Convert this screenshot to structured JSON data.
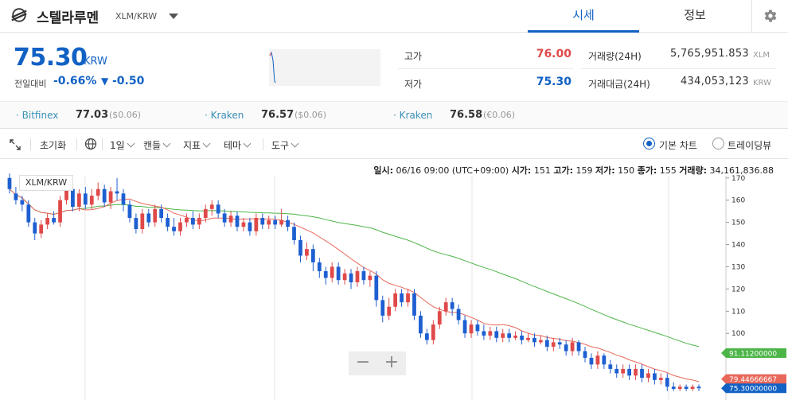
{
  "header": {
    "coin_name": "스텔라루멘",
    "pair": "XLM/KRW",
    "tabs": [
      "시세",
      "정보"
    ]
  },
  "price": {
    "value": "75.30",
    "unit": "KRW",
    "change_label": "전일대비",
    "change_rate": "-0.66%",
    "change_arrow": "▼",
    "change_amount": "-0.50"
  },
  "stats": {
    "high_label": "고가",
    "high_value": "76.00",
    "low_label": "저가",
    "low_value": "75.30",
    "volume_label": "거래량(24H)",
    "volume_value": "5,765,951.853",
    "volume_unit": "XLM",
    "amount_label": "거래대금(24H)",
    "amount_value": "434,053,123",
    "amount_unit": "KRW"
  },
  "exchanges": [
    {
      "name": "Bitfinex",
      "price": "77.03",
      "sub": "($0.06)"
    },
    {
      "name": "Kraken",
      "price": "76.57",
      "sub": "($0.06)"
    },
    {
      "name": "Kraken",
      "price": "76.58",
      "sub": "(€0.06)"
    }
  ],
  "toolbar": {
    "reset": "초기화",
    "period": "1일",
    "candle": "캔들",
    "indicator": "지표",
    "theme": "테마",
    "tools": "도구",
    "basic_chart": "기본 차트",
    "trading_view": "트레이딩뷰"
  },
  "ohlc": {
    "date_label": "일시:",
    "date": "06/16 09:00 (UTC+09:00)",
    "open_label": "시가:",
    "open": "151",
    "high_label": "고가:",
    "high": "159",
    "low_label": "저가:",
    "low": "150",
    "close_label": "종가:",
    "close": "155",
    "volume_label": "거래량:",
    "volume": "34,161,836.88"
  },
  "chart_pair_tag": "XLM/KRW",
  "zoom": {
    "minus": "−",
    "plus": "+"
  },
  "colors": {
    "accent": "#1261c4",
    "up": "#e04949",
    "down": "#1d5fd1",
    "ma_short": "#e8685a",
    "ma_long": "#4db548"
  },
  "chart_data": {
    "type": "candlestick",
    "ylim": [
      70,
      171
    ],
    "y_ticks": [
      170,
      160,
      150,
      140,
      130,
      120,
      110,
      100,
      90,
      80
    ],
    "price_tags": [
      {
        "value": 91.112,
        "label": "91.11200000",
        "color": "#4db548"
      },
      {
        "value": 79.44666667,
        "label": "79.44666667",
        "color": "#e8685a"
      },
      {
        "value": 75.3,
        "label": "75.30000000",
        "color": "#1261c4"
      }
    ],
    "candles": [
      [
        170,
        165,
        172,
        163
      ],
      [
        163,
        160,
        166,
        158
      ],
      [
        160,
        158,
        162,
        155
      ],
      [
        158,
        150,
        160,
        148
      ],
      [
        150,
        145,
        152,
        142
      ],
      [
        145,
        149,
        151,
        143
      ],
      [
        149,
        152,
        154,
        147
      ],
      [
        152,
        150,
        155,
        149
      ],
      [
        150,
        160,
        162,
        148
      ],
      [
        160,
        165,
        168,
        158
      ],
      [
        165,
        157,
        167,
        155
      ],
      [
        157,
        163,
        165,
        155
      ],
      [
        163,
        158,
        166,
        156
      ],
      [
        158,
        162,
        165,
        156
      ],
      [
        162,
        165,
        168,
        160
      ],
      [
        165,
        159,
        167,
        157
      ],
      [
        159,
        164,
        166,
        156
      ],
      [
        164,
        163,
        170,
        160
      ],
      [
        163,
        158,
        165,
        155
      ],
      [
        158,
        152,
        160,
        150
      ],
      [
        152,
        147,
        154,
        145
      ],
      [
        147,
        154,
        156,
        145
      ],
      [
        154,
        150,
        156,
        148
      ],
      [
        150,
        156,
        158,
        148
      ],
      [
        156,
        152,
        158,
        150
      ],
      [
        152,
        148,
        154,
        146
      ],
      [
        148,
        146,
        152,
        144
      ],
      [
        146,
        150,
        152,
        144
      ],
      [
        150,
        152,
        154,
        148
      ],
      [
        152,
        149,
        155,
        147
      ],
      [
        149,
        152,
        154,
        147
      ],
      [
        152,
        156,
        158,
        150
      ],
      [
        156,
        158,
        160,
        153
      ],
      [
        158,
        154,
        160,
        152
      ],
      [
        154,
        150,
        156,
        148
      ],
      [
        150,
        153,
        155,
        148
      ],
      [
        153,
        148,
        155,
        146
      ],
      [
        148,
        150,
        152,
        146
      ],
      [
        150,
        146,
        152,
        144
      ],
      [
        146,
        152,
        154,
        144
      ],
      [
        152,
        149,
        154,
        147
      ],
      [
        149,
        151,
        153,
        147
      ],
      [
        151,
        149,
        153,
        147
      ],
      [
        149,
        151,
        156,
        148
      ],
      [
        151,
        148,
        153,
        146
      ],
      [
        148,
        142,
        150,
        140
      ],
      [
        142,
        135,
        144,
        132
      ],
      [
        135,
        138,
        141,
        133
      ],
      [
        138,
        132,
        140,
        128
      ],
      [
        132,
        128,
        134,
        125
      ],
      [
        128,
        125,
        130,
        122
      ],
      [
        125,
        130,
        132,
        123
      ],
      [
        130,
        124,
        132,
        122
      ],
      [
        124,
        127,
        129,
        122
      ],
      [
        127,
        123,
        129,
        120
      ],
      [
        123,
        128,
        130,
        121
      ],
      [
        128,
        124,
        130,
        122
      ],
      [
        124,
        126,
        128,
        121
      ],
      [
        126,
        115,
        128,
        112
      ],
      [
        115,
        108,
        117,
        105
      ],
      [
        108,
        112,
        116,
        106
      ],
      [
        112,
        118,
        120,
        110
      ],
      [
        118,
        114,
        120,
        112
      ],
      [
        114,
        118,
        120,
        112
      ],
      [
        118,
        108,
        120,
        106
      ],
      [
        108,
        100,
        110,
        98
      ],
      [
        100,
        97,
        102,
        95
      ],
      [
        97,
        104,
        106,
        95
      ],
      [
        104,
        110,
        112,
        102
      ],
      [
        110,
        114,
        116,
        108
      ],
      [
        114,
        111,
        116,
        108
      ],
      [
        111,
        106,
        113,
        104
      ],
      [
        106,
        100,
        108,
        98
      ],
      [
        100,
        104,
        106,
        98
      ],
      [
        104,
        101,
        106,
        99
      ],
      [
        101,
        99,
        104,
        97
      ],
      [
        99,
        101,
        103,
        97
      ],
      [
        101,
        98,
        103,
        96
      ],
      [
        98,
        100,
        102,
        96
      ],
      [
        100,
        98,
        102,
        96
      ],
      [
        98,
        99,
        101,
        97
      ],
      [
        99,
        97,
        101,
        95
      ],
      [
        97,
        98,
        100,
        96
      ],
      [
        98,
        96,
        100,
        94
      ],
      [
        96,
        97,
        99,
        95
      ],
      [
        97,
        94,
        99,
        92
      ],
      [
        94,
        96,
        98,
        92
      ],
      [
        96,
        95,
        98,
        93
      ],
      [
        95,
        92,
        97,
        90
      ],
      [
        92,
        96,
        98,
        90
      ],
      [
        96,
        92,
        97,
        90
      ],
      [
        92,
        89,
        94,
        87
      ],
      [
        89,
        86,
        91,
        84
      ],
      [
        86,
        90,
        92,
        84
      ],
      [
        90,
        86,
        91,
        84
      ],
      [
        86,
        84,
        88,
        82
      ],
      [
        84,
        82,
        86,
        80
      ],
      [
        82,
        84,
        86,
        80
      ],
      [
        84,
        81,
        86,
        79
      ],
      [
        81,
        84,
        86,
        79
      ],
      [
        84,
        80,
        86,
        78
      ],
      [
        80,
        82,
        84,
        78
      ],
      [
        82,
        79,
        84,
        77
      ],
      [
        79,
        80,
        82,
        77
      ],
      [
        80,
        76,
        82,
        74
      ],
      [
        76,
        75,
        78,
        74
      ],
      [
        75,
        76,
        77,
        74
      ],
      [
        76,
        75,
        77,
        74
      ],
      [
        75,
        76,
        77,
        74
      ],
      [
        76,
        75.3,
        77,
        74
      ]
    ]
  }
}
